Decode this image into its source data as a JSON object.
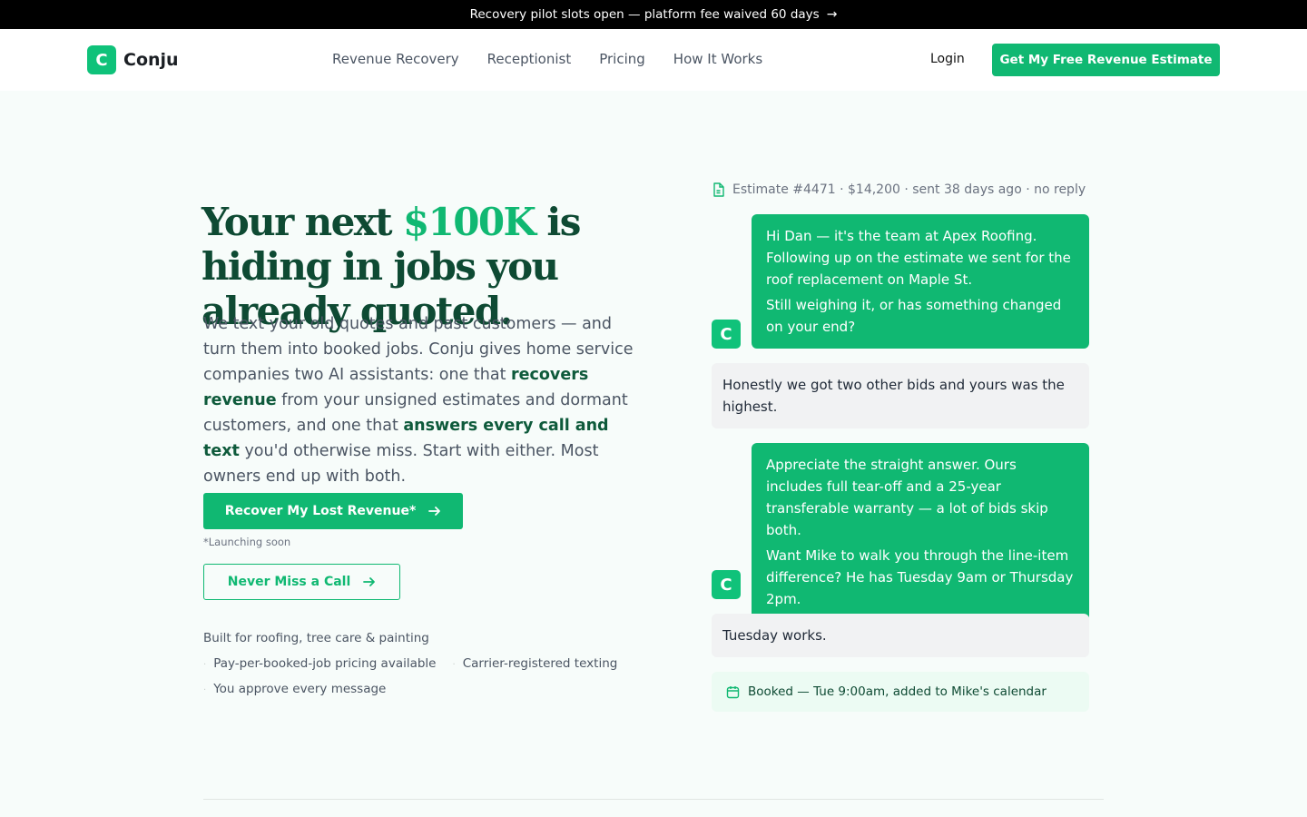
{
  "banner": {
    "text": "Recovery pilot slots open — platform fee waived 60 days",
    "arrow": "→"
  },
  "nav": {
    "logo_letter": "C",
    "brand": "Conju",
    "links": [
      "Revenue Recovery",
      "Receptionist",
      "Pricing",
      "How It Works"
    ],
    "login": "Login",
    "cta": "Get My Free Revenue Estimate"
  },
  "hero": {
    "headline_pre": "Your next ",
    "headline_accent": "$100K",
    "headline_post": " is hiding in jobs you already quoted.",
    "lede_1": "We text your old quotes and past customers — and turn them into booked jobs. Conju gives home service companies two AI assistants: one that ",
    "lede_bold_1": "recovers revenue",
    "lede_2": " from your unsigned estimates and dormant customers, and one that ",
    "lede_bold_2": "answers every call and text",
    "lede_3": " you'd otherwise miss. Start with either. Most owners end up with both.",
    "primary_button": "Recover My Lost Revenue*",
    "launch_note": "*Launching soon",
    "secondary_button": "Never Miss a Call",
    "built_for": "Built for roofing, tree care & painting",
    "features": [
      "Pay-per-booked-job pricing available",
      "Carrier-registered texting",
      "You approve every message"
    ]
  },
  "conversation": {
    "estimate_line": "Estimate #4471 · $14,200 · sent 38 days ago · no reply",
    "avatar_letter": "C",
    "msg1_p1": "Hi Dan — it's the team at Apex Roofing. Following up on the estimate we sent for the roof replacement on Maple St.",
    "msg1_p2": "Still weighing it, or has something changed on your end?",
    "reply1": "Honestly we got two other bids and yours was the highest.",
    "msg2_p1": "Appreciate the straight answer. Ours includes full tear-off and a 25-year transferable warranty — a lot of bids skip both.",
    "msg2_p2": "Want Mike to walk you through the line-item difference? He has Tuesday 9am or Thursday 2pm.",
    "reply2": "Tuesday works.",
    "booked": "Booked — Tue 9:00am, added to Mike's calendar"
  },
  "icons": {
    "arrow": "arrow-right-icon",
    "document": "document-icon",
    "calendar": "calendar-icon"
  },
  "colors": {
    "brand_green": "#10b872",
    "dark_green": "#0e4a33",
    "banner_bg": "#000000",
    "page_bg": "#f7fcfa"
  }
}
